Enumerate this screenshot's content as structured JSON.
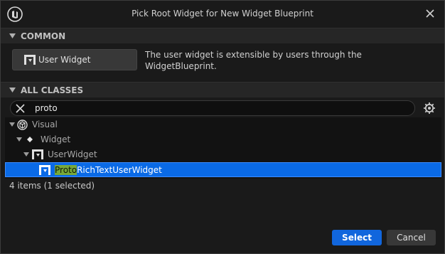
{
  "window": {
    "title": "Pick Root Widget for New Widget Blueprint"
  },
  "common": {
    "header": "COMMON",
    "button_label": "User Widget",
    "description": "The user widget is extensible by users through the WidgetBlueprint."
  },
  "all_classes": {
    "header": "ALL CLASSES",
    "search_value": "proto"
  },
  "tree": {
    "visual": "Visual",
    "widget": "Widget",
    "user_widget": "UserWidget",
    "selected_match": "Proto",
    "selected_rest": "RichTextUserWidget"
  },
  "status": "4 items (1 selected)",
  "buttons": {
    "select": "Select",
    "cancel": "Cancel"
  },
  "colors": {
    "accent": "#1166dd",
    "selection": "#0a6ae6",
    "highlight": "#78a83a"
  },
  "icons": [
    "unreal-logo-icon",
    "close-icon",
    "caret-down-icon",
    "widget-blueprint-icon",
    "clear-icon",
    "gear-icon",
    "visual-icon",
    "diamond-icon"
  ]
}
